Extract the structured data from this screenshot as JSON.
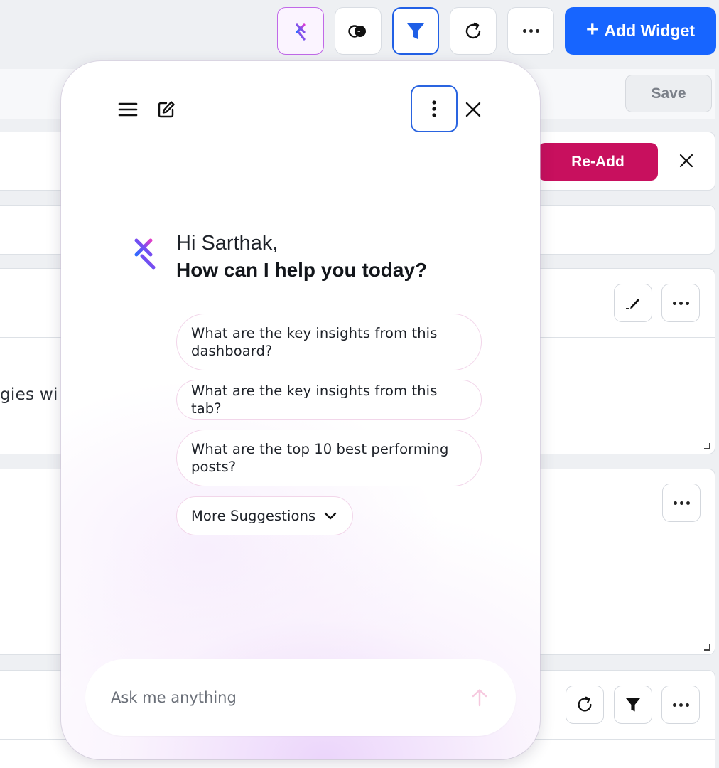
{
  "toolbar": {
    "add_widget_label": "Add Widget",
    "add_widget_icon": "plus-icon",
    "buttons": [
      "ai-sparkle-icon",
      "toggle-icon",
      "filter-icon",
      "refresh-icon",
      "more-horizontal-icon"
    ]
  },
  "dashboard": {
    "save_label": "Save",
    "readd_label": "Re-Add",
    "widget_text_fragment": "gies wi"
  },
  "assistant": {
    "greeting_line1": "Hi Sarthak,",
    "greeting_line2": "How can I help you today?",
    "suggestions": [
      {
        "label": "What are the key insights from this dashboard?"
      },
      {
        "label": "What are the key insights from this tab?"
      },
      {
        "label": "What are the top 10 best performing posts?"
      }
    ],
    "more_suggestions_label": "More Suggestions",
    "input": {
      "value": "",
      "placeholder": "Ask me anything"
    }
  },
  "colors": {
    "primary": "#1765ff",
    "readd": "#c8105e",
    "focus_border": "#2a64e0",
    "ai_accent": "#c169e8"
  }
}
